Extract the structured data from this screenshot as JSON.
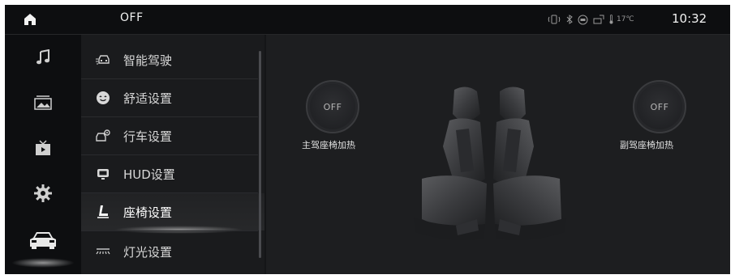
{
  "status_bar": {
    "home_icon": "home-icon",
    "status_text": "OFF",
    "temperature": "17℃",
    "time": "10:32",
    "icons": [
      "vibrate-icon",
      "bluetooth-icon",
      "nfc-icon",
      "signal-icon",
      "thermometer-icon"
    ]
  },
  "rail": {
    "items": [
      {
        "name": "music",
        "icon": "music-note-icon"
      },
      {
        "name": "gallery",
        "icon": "image-icon"
      },
      {
        "name": "video",
        "icon": "tv-icon"
      },
      {
        "name": "settings",
        "icon": "gear-icon"
      },
      {
        "name": "car",
        "icon": "car-icon",
        "active": true
      }
    ]
  },
  "menu": {
    "items": [
      {
        "label": "智能驾驶",
        "icon": "assisted-driving-icon"
      },
      {
        "label": "舒适设置",
        "icon": "comfort-icon"
      },
      {
        "label": "行车设置",
        "icon": "car-settings-icon"
      },
      {
        "label": "HUD设置",
        "icon": "hud-icon"
      },
      {
        "label": "座椅设置",
        "icon": "seat-icon",
        "selected": true
      },
      {
        "label": "灯光设置",
        "icon": "headlight-icon"
      }
    ]
  },
  "content": {
    "driver_heat": {
      "state": "OFF",
      "label": "主驾座椅加热"
    },
    "passenger_heat": {
      "state": "OFF",
      "label": "副驾座椅加热"
    }
  },
  "colors": {
    "background": "#141517",
    "panel": "#1d1e20",
    "text": "#d8d8d8"
  }
}
